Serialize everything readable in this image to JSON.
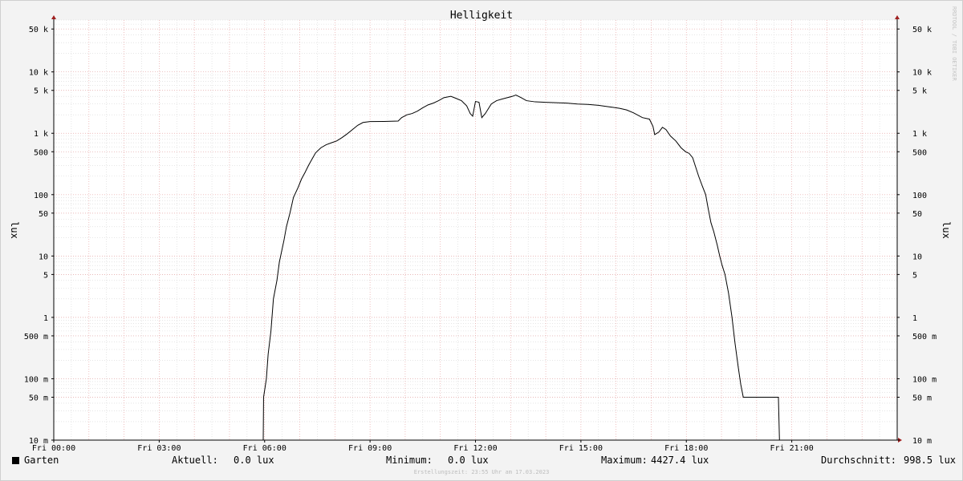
{
  "chart_data": {
    "type": "line",
    "title": "Helligkeit",
    "ylabel": "lux",
    "y_scale": "log",
    "ylim": [
      0.01,
      70000
    ],
    "xlim_hours": [
      0,
      24
    ],
    "grid": true,
    "x_ticks": [
      {
        "label": "Fri 00:00",
        "hour": 0
      },
      {
        "label": "Fri 03:00",
        "hour": 3
      },
      {
        "label": "Fri 06:00",
        "hour": 6
      },
      {
        "label": "Fri 09:00",
        "hour": 9
      },
      {
        "label": "Fri 12:00",
        "hour": 12
      },
      {
        "label": "Fri 15:00",
        "hour": 15
      },
      {
        "label": "Fri 18:00",
        "hour": 18
      },
      {
        "label": "Fri 21:00",
        "hour": 21
      }
    ],
    "y_ticks": [
      {
        "label": "10 m",
        "value": 0.01
      },
      {
        "label": "50 m",
        "value": 0.05
      },
      {
        "label": "100 m",
        "value": 0.1
      },
      {
        "label": "500 m",
        "value": 0.5
      },
      {
        "label": "1",
        "value": 1
      },
      {
        "label": "5",
        "value": 5
      },
      {
        "label": "10",
        "value": 10
      },
      {
        "label": "50",
        "value": 50
      },
      {
        "label": "100",
        "value": 100
      },
      {
        "label": "500",
        "value": 500
      },
      {
        "label": "1 k",
        "value": 1000
      },
      {
        "label": "5 k",
        "value": 5000
      },
      {
        "label": "10 k",
        "value": 10000
      },
      {
        "label": "50 k",
        "value": 50000
      }
    ],
    "series": [
      {
        "name": "Garten",
        "color": "#000000",
        "points": [
          [
            0.0,
            0.01
          ],
          [
            5.96,
            0.01
          ],
          [
            5.97,
            0.05
          ],
          [
            6.05,
            0.1
          ],
          [
            6.1,
            0.25
          ],
          [
            6.18,
            0.6
          ],
          [
            6.25,
            2
          ],
          [
            6.35,
            4
          ],
          [
            6.42,
            8
          ],
          [
            6.55,
            18
          ],
          [
            6.62,
            30
          ],
          [
            6.72,
            50
          ],
          [
            6.82,
            90
          ],
          [
            6.95,
            130
          ],
          [
            7.05,
            180
          ],
          [
            7.15,
            230
          ],
          [
            7.25,
            300
          ],
          [
            7.35,
            380
          ],
          [
            7.45,
            480
          ],
          [
            7.6,
            580
          ],
          [
            7.75,
            650
          ],
          [
            7.9,
            700
          ],
          [
            8.05,
            750
          ],
          [
            8.2,
            850
          ],
          [
            8.35,
            980
          ],
          [
            8.5,
            1150
          ],
          [
            8.65,
            1350
          ],
          [
            8.8,
            1500
          ],
          [
            9.0,
            1550
          ],
          [
            9.4,
            1560
          ],
          [
            9.8,
            1580
          ],
          [
            9.9,
            1800
          ],
          [
            10.05,
            2000
          ],
          [
            10.2,
            2100
          ],
          [
            10.35,
            2300
          ],
          [
            10.5,
            2600
          ],
          [
            10.65,
            2900
          ],
          [
            10.8,
            3100
          ],
          [
            10.95,
            3400
          ],
          [
            11.1,
            3800
          ],
          [
            11.3,
            4000
          ],
          [
            11.45,
            3700
          ],
          [
            11.6,
            3400
          ],
          [
            11.75,
            2800
          ],
          [
            11.85,
            2100
          ],
          [
            11.92,
            1900
          ],
          [
            12.0,
            3300
          ],
          [
            12.1,
            3200
          ],
          [
            12.18,
            1800
          ],
          [
            12.28,
            2100
          ],
          [
            12.45,
            3000
          ],
          [
            12.6,
            3400
          ],
          [
            12.75,
            3600
          ],
          [
            12.9,
            3800
          ],
          [
            13.05,
            4000
          ],
          [
            13.15,
            4200
          ],
          [
            13.3,
            3800
          ],
          [
            13.45,
            3400
          ],
          [
            13.7,
            3250
          ],
          [
            14.0,
            3200
          ],
          [
            14.3,
            3150
          ],
          [
            14.6,
            3100
          ],
          [
            14.9,
            3000
          ],
          [
            15.2,
            2950
          ],
          [
            15.5,
            2850
          ],
          [
            15.8,
            2700
          ],
          [
            16.1,
            2550
          ],
          [
            16.3,
            2400
          ],
          [
            16.5,
            2150
          ],
          [
            16.75,
            1800
          ],
          [
            16.95,
            1700
          ],
          [
            17.05,
            1300
          ],
          [
            17.1,
            950
          ],
          [
            17.22,
            1050
          ],
          [
            17.32,
            1250
          ],
          [
            17.42,
            1150
          ],
          [
            17.55,
            900
          ],
          [
            17.7,
            750
          ],
          [
            17.85,
            580
          ],
          [
            17.98,
            500
          ],
          [
            18.08,
            470
          ],
          [
            18.18,
            400
          ],
          [
            18.25,
            300
          ],
          [
            18.35,
            200
          ],
          [
            18.45,
            140
          ],
          [
            18.55,
            100
          ],
          [
            18.62,
            60
          ],
          [
            18.7,
            35
          ],
          [
            18.78,
            25
          ],
          [
            18.88,
            15
          ],
          [
            18.95,
            10
          ],
          [
            19.02,
            7
          ],
          [
            19.1,
            5
          ],
          [
            19.2,
            2.5
          ],
          [
            19.3,
            1
          ],
          [
            19.38,
            0.4
          ],
          [
            19.48,
            0.15
          ],
          [
            19.55,
            0.08
          ],
          [
            19.62,
            0.05
          ],
          [
            20.62,
            0.05
          ],
          [
            20.65,
            0.01
          ],
          [
            24.0,
            0.01
          ]
        ]
      }
    ],
    "legend": {
      "name": "Garten",
      "current_label": "Aktuell:",
      "current_value": "0.0 lux",
      "min_label": "Minimum:",
      "min_value": "0.0 lux",
      "max_label": "Maximum:",
      "max_value": "4427.4 lux",
      "avg_label": "Durchschnitt:",
      "avg_value": "998.5 lux"
    },
    "watermark": "RRDTOOL / TOBI OETIKER",
    "footer": "Erstellungszeit: 23:55 Uhr am 17.03.2023"
  }
}
